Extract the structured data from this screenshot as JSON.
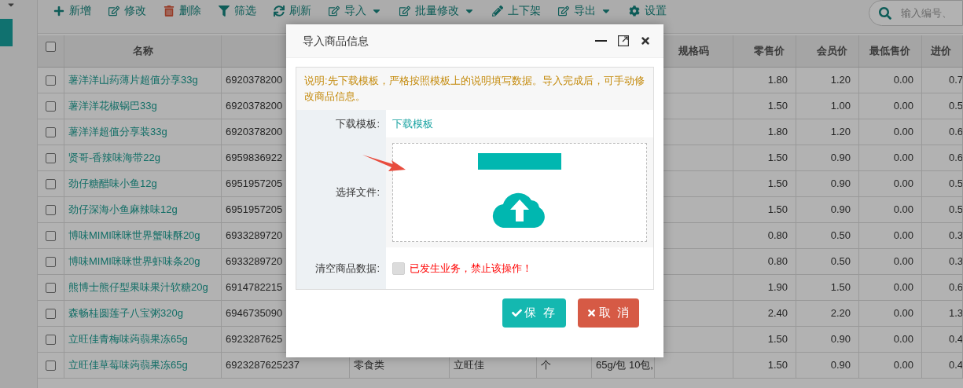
{
  "toolbar": [
    {
      "label": "新增",
      "kind": "add",
      "dropdown": false
    },
    {
      "label": "修改",
      "kind": "edit",
      "dropdown": false
    },
    {
      "label": "删除",
      "kind": "delete",
      "dropdown": false
    },
    {
      "label": "筛选",
      "kind": "filter",
      "dropdown": false
    },
    {
      "label": "刷新",
      "kind": "refresh",
      "dropdown": false
    },
    {
      "label": "导入",
      "kind": "edit",
      "dropdown": true
    },
    {
      "label": "批量修改",
      "kind": "edit",
      "dropdown": true
    },
    {
      "label": "上下架",
      "kind": "shelf",
      "dropdown": false
    },
    {
      "label": "导出",
      "kind": "edit",
      "dropdown": true
    },
    {
      "label": "设置",
      "kind": "settings",
      "dropdown": false
    }
  ],
  "search": {
    "placeholder": "输入编号、"
  },
  "table": {
    "header_checked": false,
    "columns": [
      "名称",
      "规格码",
      "零售价",
      "会员价",
      "最低售价",
      "进价"
    ],
    "rows": [
      {
        "checked": false,
        "name": "薯洋洋山药薄片超值分享33g",
        "column_2": "6920378200",
        "retail_price": "1.80",
        "member_price": "1.20",
        "min_price": "0.00",
        "cost_price": "0.7"
      },
      {
        "checked": false,
        "name": "薯洋洋花椒锅巴33g",
        "column_2": "6920378200",
        "retail_price": "1.50",
        "member_price": "1.00",
        "min_price": "0.00",
        "cost_price": "0.5"
      },
      {
        "checked": false,
        "name": "薯洋洋超值分享装33g",
        "column_2": "6920378200",
        "retail_price": "1.80",
        "member_price": "1.20",
        "min_price": "0.00",
        "cost_price": "0.6"
      },
      {
        "checked": false,
        "name": "贤哥-香辣味海带22g",
        "column_2": "6959836922",
        "retail_price": "1.50",
        "member_price": "0.90",
        "min_price": "0.00",
        "cost_price": "0.6"
      },
      {
        "checked": false,
        "name": "劲仔糖醋味小鱼12g",
        "column_2": "6951957205",
        "retail_price": "1.50",
        "member_price": "0.90",
        "min_price": "0.00",
        "cost_price": "0.5"
      },
      {
        "checked": false,
        "name": "劲仔深海小鱼麻辣味12g",
        "column_2": "6951957205",
        "retail_price": "1.50",
        "member_price": "0.90",
        "min_price": "0.00",
        "cost_price": "0.5"
      },
      {
        "checked": false,
        "name": "博味MIMI咪咪世界蟹味酥20g",
        "column_2": "6933289720",
        "retail_price": "0.80",
        "member_price": "0.50",
        "min_price": "0.00",
        "cost_price": "0.3"
      },
      {
        "checked": false,
        "name": "博味MIMI咪咪世界虾味条20g",
        "column_2": "6933289720",
        "retail_price": "0.80",
        "member_price": "0.50",
        "min_price": "0.00",
        "cost_price": "0.3"
      },
      {
        "checked": false,
        "name": "熊博士熊仔型果味果汁软糖20g",
        "column_2": "6914782215",
        "retail_price": "1.90",
        "member_price": "1.50",
        "min_price": "0.00",
        "cost_price": "0.6"
      },
      {
        "checked": false,
        "name": "森畅桂圆莲子八宝粥320g",
        "column_2": "6946735090",
        "retail_price": "2.40",
        "member_price": "2.20",
        "min_price": "0.00",
        "cost_price": "1.3"
      },
      {
        "checked": false,
        "name": "立旺佳青梅味蒟蒻果冻65g",
        "column_2": "6923287625",
        "retail_price": "1.50",
        "member_price": "0.90",
        "min_price": "0.00",
        "cost_price": "0.4"
      },
      {
        "checked": false,
        "name": "立旺佳草莓味蒟蒻果冻65g",
        "column_2": "6923287625237",
        "column_3": "零食类",
        "column_4": "立旺佳",
        "column_5": "个",
        "column_6": "65g/包 10包,",
        "retail_price": "1.50",
        "member_price": "0.90",
        "min_price": "0.00",
        "cost_price": "0.4"
      }
    ]
  },
  "dialog": {
    "title": "导入商品信息",
    "notice": "说明:先下载模板，严格按照模板上的说明填写数据。导入完成后，可手动修改商品信息。",
    "download": {
      "label": "下载模板:",
      "link": "下载模板"
    },
    "file": {
      "label": "选择文件:"
    },
    "clear": {
      "label": "清空商品数据:",
      "checked": false,
      "disabled": true,
      "warning": "已发生业务，禁止该操作！"
    },
    "buttons": [
      {
        "kind": "save",
        "label": "保 存"
      },
      {
        "kind": "cancel",
        "label": "取 消"
      }
    ]
  }
}
